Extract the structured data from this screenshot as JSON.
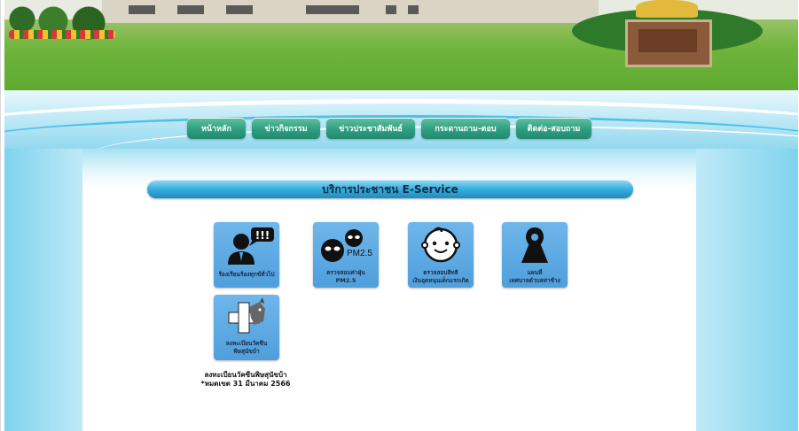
{
  "nav": {
    "items": [
      {
        "label": "หน้าหลัก"
      },
      {
        "label": "ข่าวกิจกรรม"
      },
      {
        "label": "ข่าวประชาสัมพันธ์"
      },
      {
        "label": "กระดานถาม-ตอบ"
      },
      {
        "label": "ติดต่อ-สอบถาม"
      }
    ]
  },
  "section": {
    "title": "บริการประชาชน E-Service"
  },
  "services": [
    {
      "icon": "speech-user-icon",
      "line1": "ร้องเรียนร้องทุกข์ทั่วไป",
      "line2": ""
    },
    {
      "icon": "pm25-icon",
      "badge": "PM2.5",
      "line1": "ตรวจสอบค่าฝุ่น",
      "line2": "PM2.5"
    },
    {
      "icon": "baby-face-icon",
      "line1": "ตรวจสอบสิทธิ",
      "line2": "เงินอุดหนุนเด็กแรกเกิด"
    },
    {
      "icon": "map-user-icon",
      "line1": "แผนที่",
      "line2": "เทศบาลตำบลท่าช้าง"
    },
    {
      "icon": "rabies-dog-icon",
      "line1": "ลงทะเบียนวัคซีน",
      "line2": "พิษสุนัขบ้า"
    }
  ],
  "notice": {
    "line1": "ลงทะเบียนวัคซีนพิษสุนัขบ้า",
    "line2": "*หมดเขต 31 มีนาคม 2566"
  },
  "colors": {
    "nav_green": "#2f9e80",
    "bar_blue": "#3ab1de",
    "tile_blue": "#5aa8e0",
    "page_cyan": "#7fd3ee"
  }
}
